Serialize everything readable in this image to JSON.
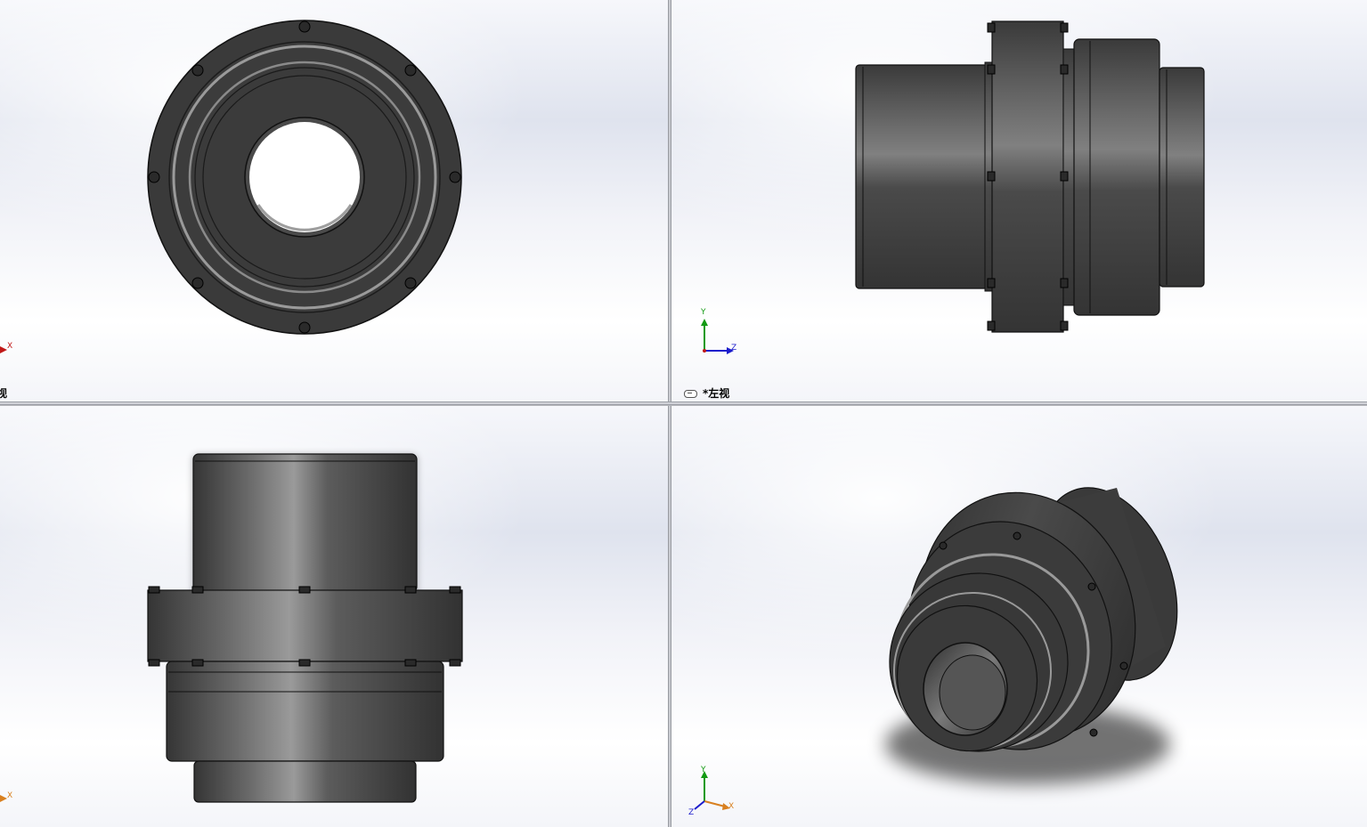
{
  "viewports": {
    "front": {
      "label_fragment": "视"
    },
    "left": {
      "label": "*左视"
    },
    "top": {},
    "iso": {}
  },
  "triads": {
    "front": {
      "x": "X"
    },
    "left": {
      "y": "Y",
      "z": "Z"
    },
    "top": {
      "x": "X"
    },
    "iso": {
      "y": "Y",
      "x": "X",
      "z": "Z"
    }
  },
  "colors": {
    "part_dark": "#3a3a3a",
    "part_light": "#a8a8a8",
    "axis_x": "#c01818",
    "axis_y": "#129a12",
    "axis_z": "#1c1ccc",
    "axis_x_iso": "#d88020"
  },
  "icons": {
    "link": "chain-link-icon"
  }
}
